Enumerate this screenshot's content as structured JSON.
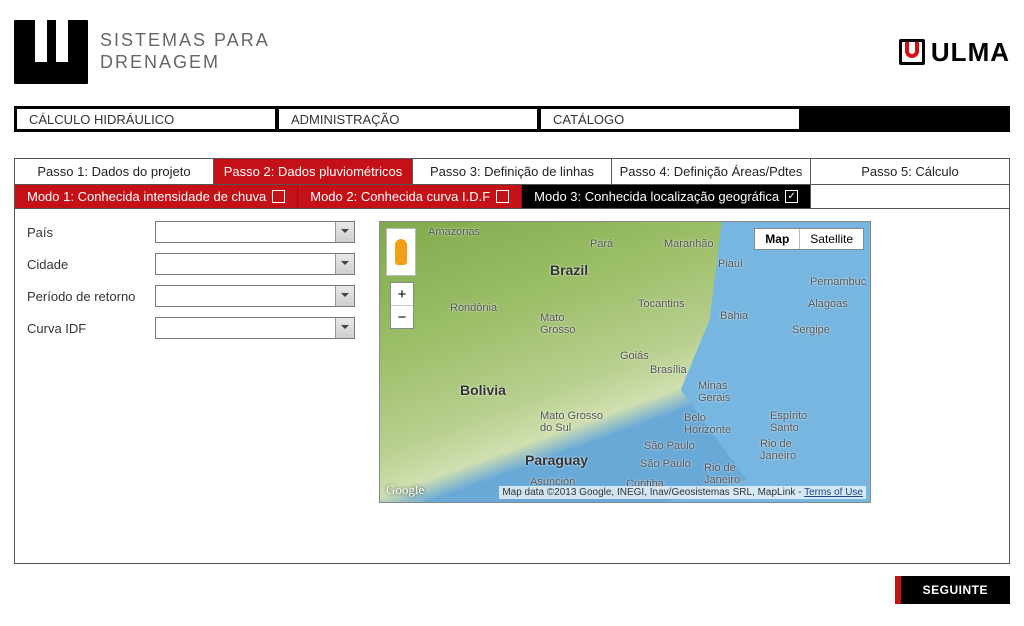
{
  "logo": {
    "line1": "SISTEMAS PARA",
    "line2": "DRENAGEM"
  },
  "brand": "ULMA",
  "nav": [
    "CÁLCULO HIDRÁULICO",
    "ADMINISTRAÇÃO",
    "CATÁLOGO"
  ],
  "steps": [
    "Passo 1: Dados do projeto",
    "Passo 2: Dados pluviométricos",
    "Passo 3: Definição de linhas",
    "Passo 4: Definição Áreas/Pdtes",
    "Passo 5: Cálculo"
  ],
  "modes": {
    "m1": "Modo 1: Conhecida intensidade de chuva",
    "m2": "Modo 2: Conhecida curva I.D.F",
    "m3": "Modo 3: Conhecida localização geográfica"
  },
  "form": {
    "pais": "País",
    "cidade": "Cidade",
    "periodo": "Período de retorno",
    "curva": "Curva IDF"
  },
  "map": {
    "btnMap": "Map",
    "btnSat": "Satellite",
    "labels": {
      "amazonas": "Amazonas",
      "para": "Pará",
      "maranhao": "Maranhão",
      "piaui": "Piauí",
      "pernambuc": "Pernambuc",
      "alagoas": "Alagoas",
      "rondonia": "Rondônia",
      "matogrosso": "Mato\nGrosso",
      "tocantins": "Tocantins",
      "bahia": "Bahia",
      "sergipe": "Sergipe",
      "goias": "Goiás",
      "brasilia": "Brasília",
      "minas": "Minas\nGerais",
      "matosul": "Mato Grosso\ndo Sul",
      "belo": "Belo\nHorizonte",
      "espirito": "Espírito\nSanto",
      "saopaulo1": "São Paulo",
      "saopaulo2": "São Paulo",
      "rioj": "Rio de\nJaneiro",
      "riojstate": "Rio de\nJaneiro",
      "curitiba": "Curitiba",
      "asuncion": "Asunción",
      "brazil": "Brazil",
      "bolivia": "Bolivia",
      "paraguay": "Paraguay"
    },
    "google": "Google",
    "attribution": "Map data ©2013 Google, INEGI, Inav/Geosistemas SRL, MapLink - ",
    "terms": "Terms of Use"
  },
  "next": "SEGUINTE"
}
